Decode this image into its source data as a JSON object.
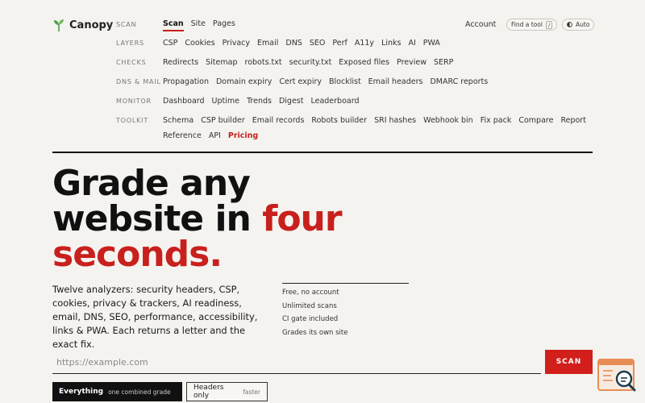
{
  "brand": {
    "name": "Canopy"
  },
  "nav": {
    "sections": [
      {
        "label": "SCAN",
        "items": [
          "Scan",
          "Site",
          "Pages"
        ],
        "active": 0
      },
      {
        "label": "LAYERS",
        "items": [
          "CSP",
          "Cookies",
          "Privacy",
          "Email",
          "DNS",
          "SEO",
          "Perf",
          "A11y",
          "Links",
          "AI",
          "PWA"
        ]
      },
      {
        "label": "CHECKS",
        "items": [
          "Redirects",
          "Sitemap",
          "robots.txt",
          "security.txt",
          "Exposed files",
          "Preview",
          "SERP"
        ]
      },
      {
        "label": "DNS & MAIL",
        "items": [
          "Propagation",
          "Domain expiry",
          "Cert expiry",
          "Blocklist",
          "Email headers",
          "DMARC reports"
        ]
      },
      {
        "label": "MONITOR",
        "items": [
          "Dashboard",
          "Uptime",
          "Trends",
          "Digest",
          "Leaderboard"
        ]
      },
      {
        "label": "TOOLKIT",
        "items": [
          "Schema",
          "CSP builder",
          "Email records",
          "Robots builder",
          "SRI hashes",
          "Webhook bin",
          "Fix pack",
          "Compare",
          "Report"
        ]
      }
    ],
    "toolkit_extra": [
      "Reference",
      "API",
      "Pricing"
    ]
  },
  "header": {
    "account": "Account",
    "find_tool": "Find a tool",
    "find_key": "/",
    "theme": "Auto",
    "theme_icon": "half-circle-icon"
  },
  "hero": {
    "line1": "Grade any",
    "line2_a": "website in ",
    "line2_b": "four",
    "line3": "seconds."
  },
  "description": "Twelve analyzers: security headers, CSP, cookies, privacy & trackers, AI readiness, email, DNS, SEO, performance, accessibility, links & PWA. Each returns a letter and the exact fix.",
  "facts": [
    "Free, no account",
    "Unlimited scans",
    "CI gate included",
    "Grades its own site"
  ],
  "scan": {
    "placeholder": "https://example.com",
    "button": "SCAN"
  },
  "modes": [
    {
      "label": "Everything",
      "sub": "one combined grade",
      "selected": true
    },
    {
      "label": "Headers only",
      "sub": "faster",
      "selected": false
    }
  ],
  "colors": {
    "accent": "#c8201c",
    "ink": "#111111",
    "paper": "#f4f3ef"
  }
}
